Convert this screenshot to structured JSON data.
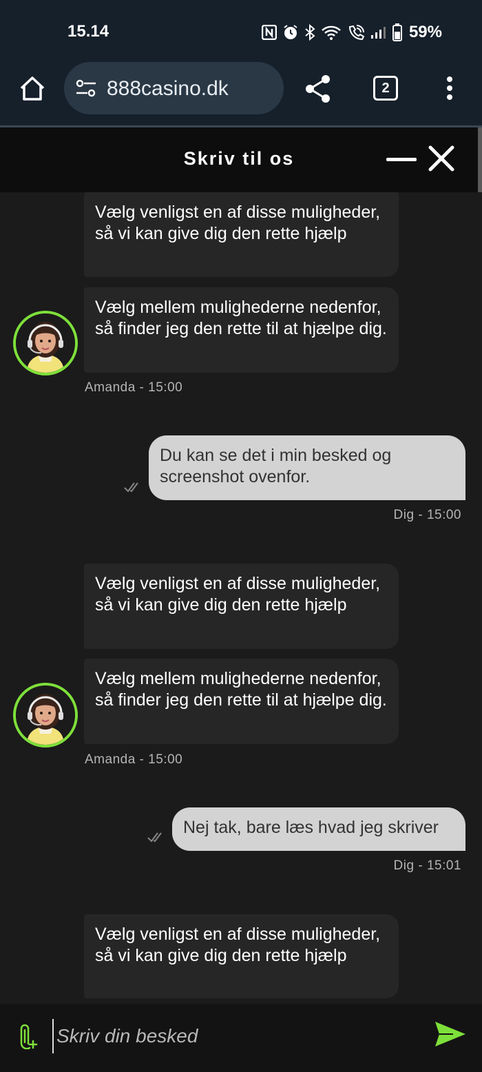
{
  "status_bar": {
    "time": "15.14",
    "battery": "59%"
  },
  "browser": {
    "url": "888casino.dk",
    "tab_count": "2"
  },
  "chat": {
    "title": "Skriv til os",
    "input_placeholder": "Skriv din besked",
    "messages": [
      {
        "sender": "bot",
        "text": "Vælg venligst en af disse muligheder, så vi kan give dig den rette hjælp"
      },
      {
        "sender": "bot",
        "text": "Vælg mellem mulighederne nedenfor, så finder jeg den rette til at hjælpe dig."
      },
      {
        "meta": "Amanda - 15:00"
      },
      {
        "sender": "user",
        "text": "Du kan se det i min besked og screenshot ovenfor."
      },
      {
        "meta": "Dig - 15:00"
      },
      {
        "sender": "bot",
        "text": "Vælg venligst en af disse muligheder, så vi kan give dig den rette hjælp"
      },
      {
        "sender": "bot",
        "text": "Vælg mellem mulighederne nedenfor, så finder jeg den rette til at hjælpe dig."
      },
      {
        "meta": "Amanda - 15:00"
      },
      {
        "sender": "user",
        "text": "Nej tak, bare læs hvad jeg skriver"
      },
      {
        "meta": "Dig - 15:01"
      },
      {
        "sender": "bot",
        "text": "Vælg venligst en af disse muligheder, så vi kan give dig den rette hjælp"
      }
    ]
  },
  "colors": {
    "accent_green": "#7ee03a",
    "status_bar_bg": "#16202b",
    "chat_bg": "#1b1b1b",
    "bot_bubble": "#262626",
    "user_bubble": "#d3d3d3"
  },
  "icons": {
    "home": "home-icon",
    "site_settings": "tune-icon",
    "share": "share-icon",
    "menu": "more-vert-icon",
    "minimize": "minimize-icon",
    "close": "close-icon",
    "attach": "attach-icon",
    "send": "send-icon",
    "read_receipt": "double-check-icon"
  }
}
